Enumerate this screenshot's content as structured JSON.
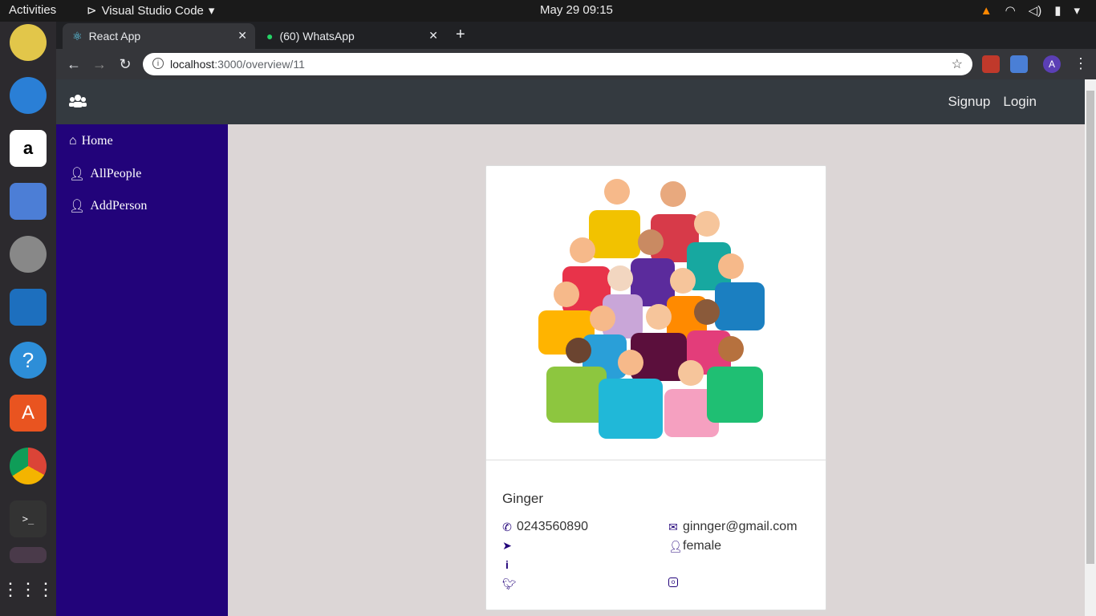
{
  "system": {
    "activities": "Activities",
    "app_name": "Visual Studio Code",
    "clock": "May 29  09:15"
  },
  "browser": {
    "tabs": [
      {
        "label": "React App"
      },
      {
        "label": "(60) WhatsApp"
      }
    ],
    "url_host": "localhost",
    "url_path": ":3000/overview/11"
  },
  "navbar": {
    "signup": "Signup",
    "login": "Login"
  },
  "sidebar": {
    "items": [
      {
        "label": "Home"
      },
      {
        "label": "AllPeople"
      },
      {
        "label": "AddPerson"
      }
    ]
  },
  "person": {
    "name": "Ginger",
    "phone": "0243560890",
    "email": "ginnger@gmail.com",
    "location": "",
    "gender": "female",
    "info": "",
    "twitter": "",
    "instagram": ""
  },
  "colors": {
    "sidebar": "#22037a",
    "navbar": "#343a40",
    "page_bg": "#dcd6d6"
  }
}
